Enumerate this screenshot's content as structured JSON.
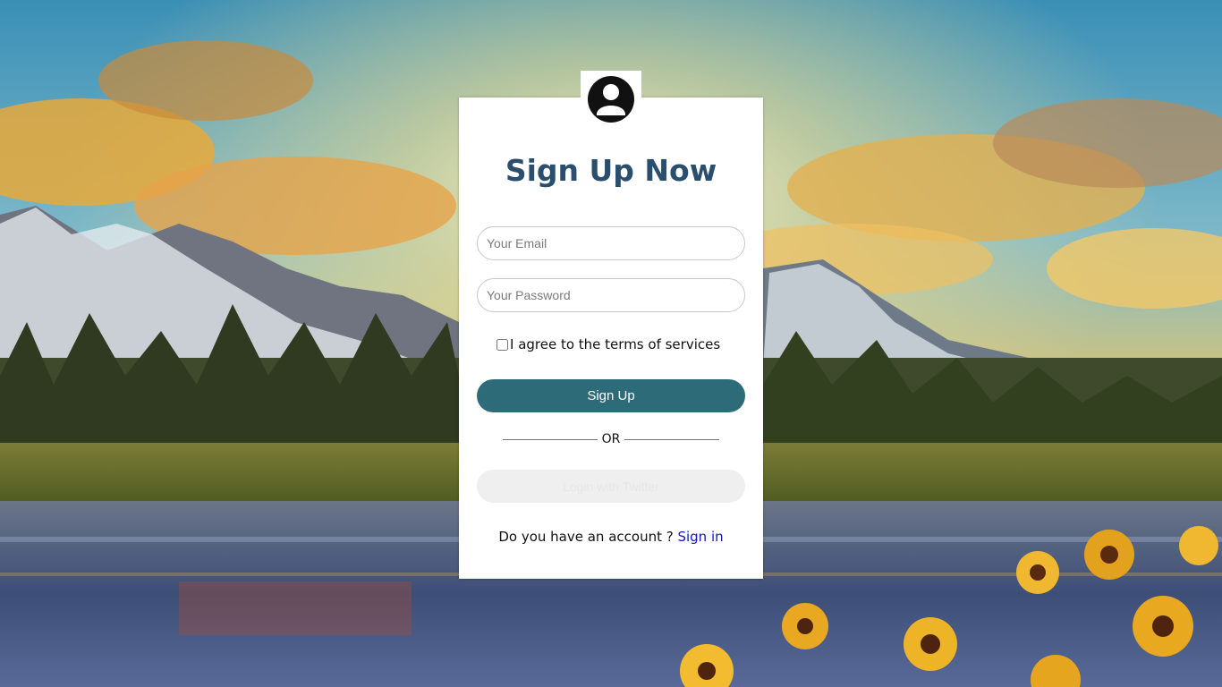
{
  "form": {
    "title": "Sign Up Now",
    "email_placeholder": "Your Email",
    "password_placeholder": "Your Password",
    "agree_label": "I agree to the terms of services",
    "signup_label": "Sign Up",
    "divider_text": "OR",
    "twitter_label": "Login with Twitter",
    "account_prompt": "Do you have an account ? ",
    "signin_link": "Sign in"
  },
  "colors": {
    "title": "#2a4e6e",
    "signup_button": "#2e6b78",
    "link": "#1515c8"
  },
  "icons": {
    "avatar": "user-circle-icon"
  }
}
